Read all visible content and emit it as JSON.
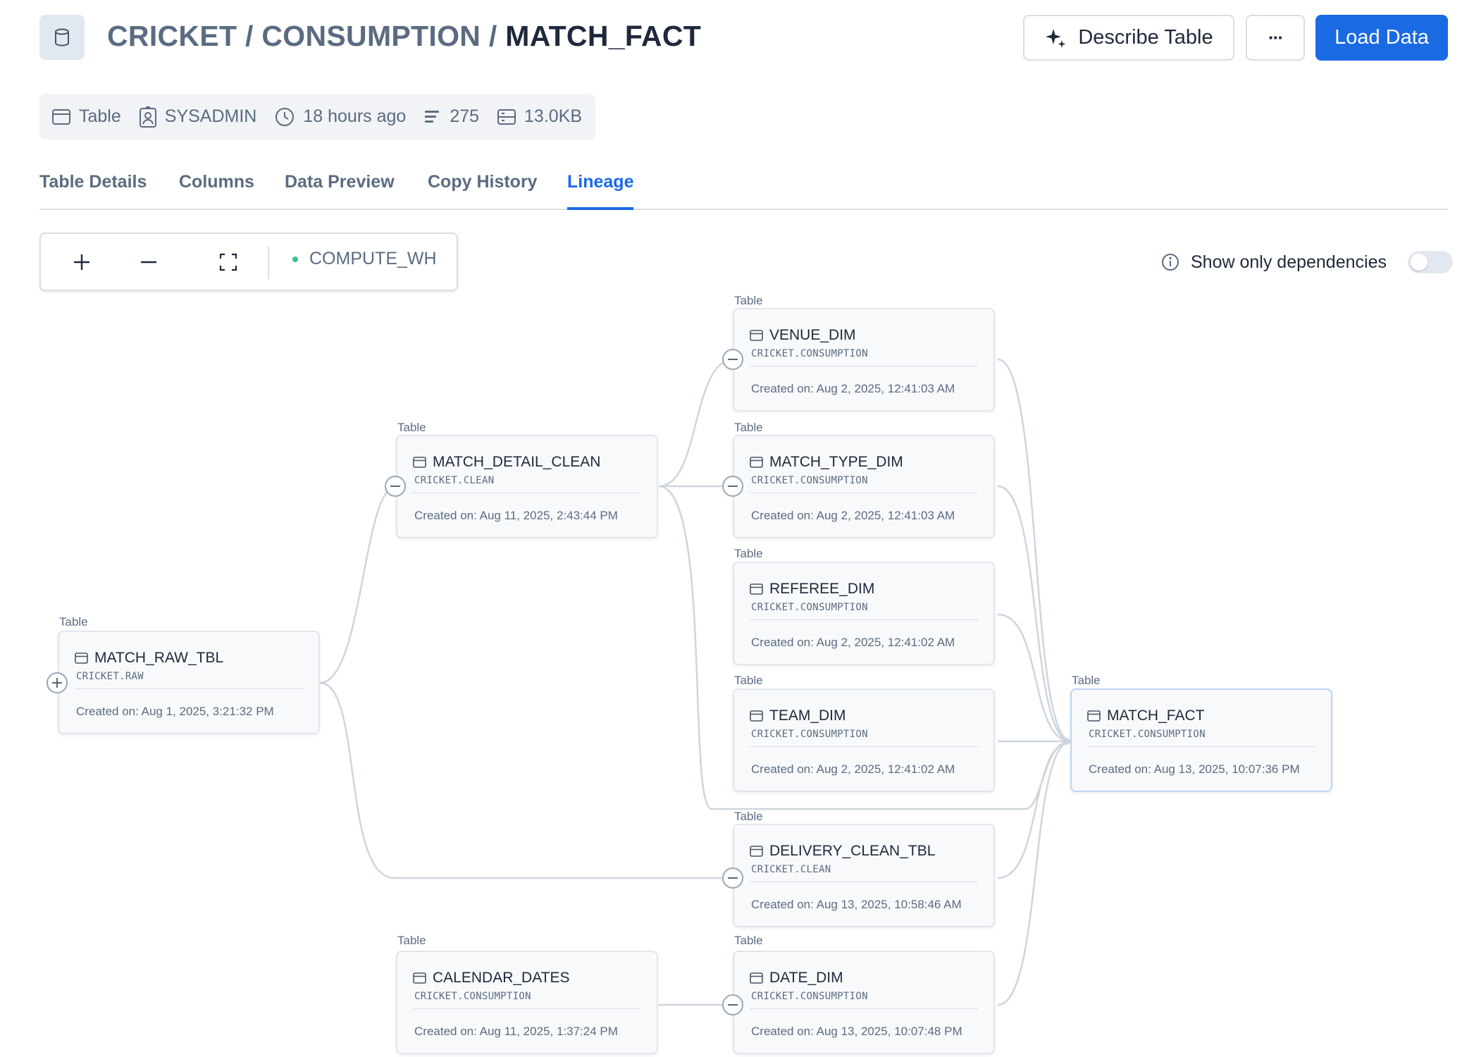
{
  "header": {
    "path_prefix": "CRICKET / CONSUMPTION / ",
    "current_table": "MATCH_FACT",
    "describe_label": "Describe Table",
    "more_label": "···",
    "load_label": "Load Data"
  },
  "meta": {
    "kind": "Table",
    "owner": "SYSADMIN",
    "updated": "18 hours ago",
    "rows": "275",
    "size": "13.0KB"
  },
  "tabs": [
    "Table Details",
    "Columns",
    "Data Preview",
    "Copy History",
    "Lineage"
  ],
  "active_tab": "Lineage",
  "toolbar": {
    "warehouse": "COMPUTE_WH",
    "show_deps_label": "Show only dependencies",
    "show_deps_on": false
  },
  "nodes": [
    {
      "kind": "Table",
      "name": "MATCH_RAW_TBL",
      "schema": "CRICKET.RAW",
      "created": "Created on: Aug 1, 2025, 3:21:32 PM"
    },
    {
      "kind": "Table",
      "name": "MATCH_DETAIL_CLEAN",
      "schema": "CRICKET.CLEAN",
      "created": "Created on: Aug 11, 2025, 2:43:44 PM"
    },
    {
      "kind": "Table",
      "name": "CALENDAR_DATES",
      "schema": "CRICKET.CONSUMPTION",
      "created": "Created on: Aug 11, 2025, 1:37:24 PM"
    },
    {
      "kind": "Table",
      "name": "VENUE_DIM",
      "schema": "CRICKET.CONSUMPTION",
      "created": "Created on: Aug 2, 2025, 12:41:03 AM"
    },
    {
      "kind": "Table",
      "name": "MATCH_TYPE_DIM",
      "schema": "CRICKET.CONSUMPTION",
      "created": "Created on: Aug 2, 2025, 12:41:03 AM"
    },
    {
      "kind": "Table",
      "name": "REFEREE_DIM",
      "schema": "CRICKET.CONSUMPTION",
      "created": "Created on: Aug 2, 2025, 12:41:02 AM"
    },
    {
      "kind": "Table",
      "name": "TEAM_DIM",
      "schema": "CRICKET.CONSUMPTION",
      "created": "Created on: Aug 2, 2025, 12:41:02 AM"
    },
    {
      "kind": "Table",
      "name": "DELIVERY_CLEAN_TBL",
      "schema": "CRICKET.CLEAN",
      "created": "Created on: Aug 13, 2025, 10:58:46 AM"
    },
    {
      "kind": "Table",
      "name": "DATE_DIM",
      "schema": "CRICKET.CONSUMPTION",
      "created": "Created on: Aug 13, 2025, 10:07:48 PM"
    },
    {
      "kind": "Table",
      "name": "MATCH_FACT",
      "schema": "CRICKET.CONSUMPTION",
      "created": "Created on: Aug 13, 2025, 10:07:36 PM"
    }
  ],
  "edges": [
    [
      "MATCH_RAW_TBL",
      "MATCH_DETAIL_CLEAN"
    ],
    [
      "MATCH_RAW_TBL",
      "DELIVERY_CLEAN_TBL"
    ],
    [
      "MATCH_DETAIL_CLEAN",
      "VENUE_DIM"
    ],
    [
      "MATCH_DETAIL_CLEAN",
      "MATCH_TYPE_DIM"
    ],
    [
      "MATCH_DETAIL_CLEAN",
      "MATCH_FACT"
    ],
    [
      "CALENDAR_DATES",
      "DATE_DIM"
    ],
    [
      "VENUE_DIM",
      "MATCH_FACT"
    ],
    [
      "MATCH_TYPE_DIM",
      "MATCH_FACT"
    ],
    [
      "REFEREE_DIM",
      "MATCH_FACT"
    ],
    [
      "TEAM_DIM",
      "MATCH_FACT"
    ],
    [
      "DELIVERY_CLEAN_TBL",
      "MATCH_FACT"
    ],
    [
      "DATE_DIM",
      "MATCH_FACT"
    ]
  ]
}
